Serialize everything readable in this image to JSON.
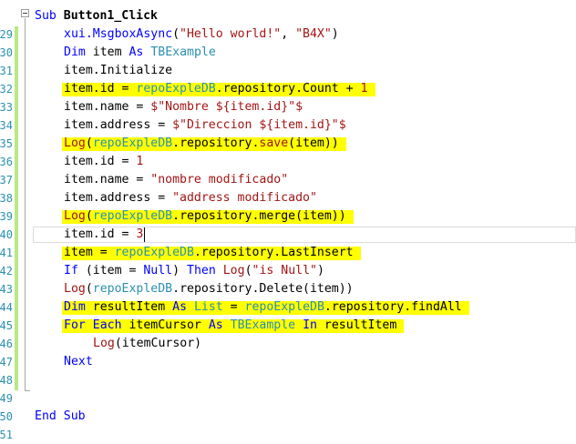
{
  "gutter": {
    "line_numbers": [
      "29",
      "30",
      "31",
      "32",
      "33",
      "34",
      "35",
      "36",
      "37",
      "38",
      "39",
      "40",
      "41",
      "42",
      "43",
      "44",
      "45",
      "46",
      "47",
      "48",
      "49",
      "50",
      "51"
    ]
  },
  "code": {
    "lines": [
      {
        "indent": 0,
        "tokens": [
          {
            "t": "Sub ",
            "c": "kw"
          },
          {
            "t": "Button1_Click",
            "c": "b"
          }
        ]
      },
      {
        "indent": 1,
        "tokens": [
          {
            "t": "xui.MsgboxAsync",
            "c": "kw"
          },
          {
            "t": "(",
            "c": ""
          },
          {
            "t": "\"Hello world!\"",
            "c": "str"
          },
          {
            "t": ", ",
            "c": ""
          },
          {
            "t": "\"B4X\"",
            "c": "str"
          },
          {
            "t": ")",
            "c": ""
          }
        ]
      },
      {
        "indent": 1,
        "tokens": [
          {
            "t": "Dim",
            "c": "kw"
          },
          {
            "t": " item ",
            "c": ""
          },
          {
            "t": "As",
            "c": "kw"
          },
          {
            "t": " ",
            "c": ""
          },
          {
            "t": "TBExample",
            "c": "type"
          }
        ]
      },
      {
        "indent": 1,
        "tokens": [
          {
            "t": "item.Initialize",
            "c": ""
          }
        ]
      },
      {
        "indent": 1,
        "tokens": [
          {
            "t": "item.id = ",
            "c": ""
          },
          {
            "t": "repoExpleDB",
            "c": "type"
          },
          {
            "t": ".repository.Count + ",
            "c": ""
          },
          {
            "t": "1",
            "c": "str"
          }
        ]
      },
      {
        "indent": 1,
        "tokens": [
          {
            "t": "item.name = ",
            "c": ""
          },
          {
            "t": "$\"Nombre ${item.id}\"$",
            "c": "str"
          }
        ]
      },
      {
        "indent": 1,
        "tokens": [
          {
            "t": "item.address = ",
            "c": ""
          },
          {
            "t": "$\"Direccion ${item.id}\"$",
            "c": "str"
          }
        ]
      },
      {
        "indent": 1,
        "tokens": [
          {
            "t": "Log",
            "c": "str"
          },
          {
            "t": "(",
            "c": ""
          },
          {
            "t": "repoExpleDB",
            "c": "type"
          },
          {
            "t": ".repository.",
            "c": ""
          },
          {
            "t": "save",
            "c": "str"
          },
          {
            "t": "(item))",
            "c": ""
          }
        ]
      },
      {
        "indent": 1,
        "tokens": [
          {
            "t": "item.id = ",
            "c": ""
          },
          {
            "t": "1",
            "c": "str"
          }
        ]
      },
      {
        "indent": 1,
        "tokens": [
          {
            "t": "item.name = ",
            "c": ""
          },
          {
            "t": "\"nombre modificado\"",
            "c": "str"
          }
        ]
      },
      {
        "indent": 1,
        "tokens": [
          {
            "t": "item.address = ",
            "c": ""
          },
          {
            "t": "\"address modificado\"",
            "c": "str"
          }
        ]
      },
      {
        "indent": 1,
        "tokens": [
          {
            "t": "Log",
            "c": "str"
          },
          {
            "t": "(",
            "c": ""
          },
          {
            "t": "repoExpleDB",
            "c": "type"
          },
          {
            "t": ".repository.merge(item))",
            "c": ""
          }
        ]
      },
      {
        "indent": 1,
        "tokens": [
          {
            "t": "item.id = ",
            "c": ""
          },
          {
            "t": "3",
            "c": "str"
          }
        ]
      },
      {
        "indent": 1,
        "tokens": [
          {
            "t": "item",
            "c": ""
          },
          {
            "t": " = ",
            "c": ""
          },
          {
            "t": "repoExpleDB",
            "c": "type"
          },
          {
            "t": ".repository.LastInsert",
            "c": ""
          }
        ]
      },
      {
        "indent": 1,
        "tokens": [
          {
            "t": "If",
            "c": "kw"
          },
          {
            "t": " (item = ",
            "c": ""
          },
          {
            "t": "Null",
            "c": "kw"
          },
          {
            "t": ") ",
            "c": ""
          },
          {
            "t": "Then",
            "c": "kw"
          },
          {
            "t": " ",
            "c": ""
          },
          {
            "t": "Log",
            "c": "str"
          },
          {
            "t": "(",
            "c": ""
          },
          {
            "t": "\"is Null\"",
            "c": "str"
          },
          {
            "t": ")",
            "c": ""
          }
        ]
      },
      {
        "indent": 1,
        "tokens": [
          {
            "t": "Log",
            "c": "str"
          },
          {
            "t": "(",
            "c": ""
          },
          {
            "t": "repoExpleDB",
            "c": "type"
          },
          {
            "t": ".repository.Delete(item))",
            "c": ""
          }
        ]
      },
      {
        "indent": 1,
        "tokens": [
          {
            "t": "Dim",
            "c": "kw"
          },
          {
            "t": " resultItem ",
            "c": ""
          },
          {
            "t": "As",
            "c": "kw"
          },
          {
            "t": " ",
            "c": ""
          },
          {
            "t": "List",
            "c": "type"
          },
          {
            "t": " = ",
            "c": ""
          },
          {
            "t": "repoExpleDB",
            "c": "type"
          },
          {
            "t": ".repository.findAll",
            "c": ""
          }
        ]
      },
      {
        "indent": 1,
        "tokens": [
          {
            "t": "For Each",
            "c": "kw"
          },
          {
            "t": " itemCursor ",
            "c": ""
          },
          {
            "t": "As",
            "c": "kw"
          },
          {
            "t": " ",
            "c": ""
          },
          {
            "t": "TBExample",
            "c": "type"
          },
          {
            "t": " ",
            "c": ""
          },
          {
            "t": "In",
            "c": "kw"
          },
          {
            "t": " resultItem",
            "c": ""
          }
        ]
      },
      {
        "indent": 2,
        "tokens": [
          {
            "t": "Log",
            "c": "str"
          },
          {
            "t": "(itemCursor)",
            "c": ""
          }
        ]
      },
      {
        "indent": 1,
        "tokens": [
          {
            "t": "Next",
            "c": "kw"
          }
        ]
      },
      {
        "indent": 1,
        "tokens": []
      },
      {
        "indent": 0,
        "tokens": []
      },
      {
        "indent": 0,
        "tokens": [
          {
            "t": "End Sub",
            "c": "kw"
          }
        ]
      }
    ]
  },
  "highlights": [
    4,
    7,
    11,
    13,
    16,
    17
  ],
  "current_line": 12,
  "colors": {
    "keyword": "#0000ff",
    "string": "#a31515",
    "type": "#2b91af",
    "highlight": "#ffff00",
    "change_bar": "#b8e986"
  }
}
